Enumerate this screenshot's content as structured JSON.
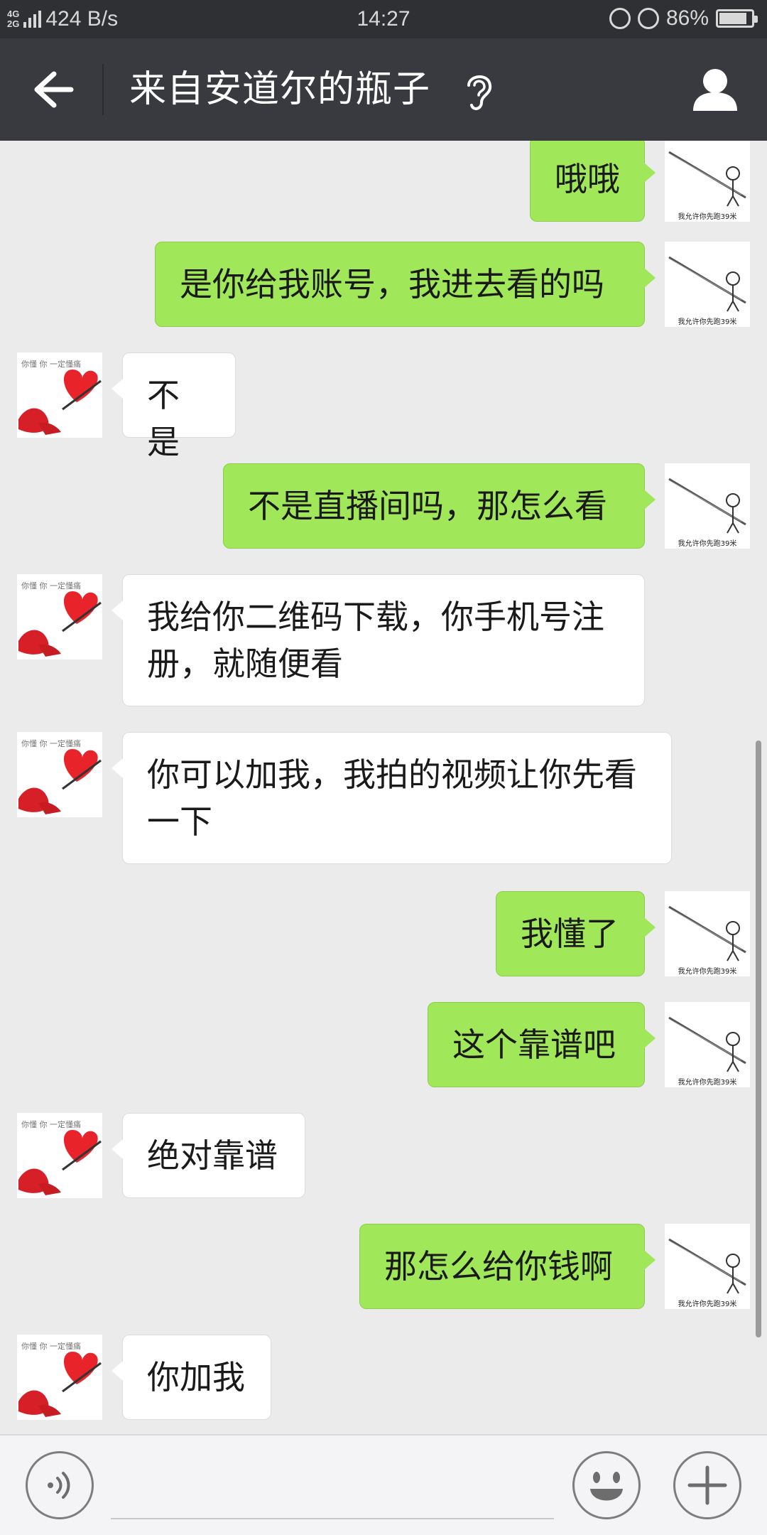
{
  "status_bar": {
    "network_top": "4G",
    "network_bottom": "2G",
    "speed": "424 B/s",
    "time": "14:27",
    "battery": "86%",
    "battery_level": 0.86
  },
  "header": {
    "title": "来自安道尔的瓶子",
    "back_icon": "arrow-left-icon",
    "ear_icon": "ear-icon",
    "profile_icon": "person-icon"
  },
  "messages": [
    {
      "sender": "me",
      "text": "哦哦"
    },
    {
      "sender": "me",
      "text": "是你给我账号，我进去看的吗"
    },
    {
      "sender": "other",
      "text": "不是"
    },
    {
      "sender": "me",
      "text": "不是直播间吗，那怎么看"
    },
    {
      "sender": "other",
      "text": "我给你二维码下载，你手机号注\n册，就随便看"
    },
    {
      "sender": "other",
      "text": "你可以加我，我拍的视频让你先看\n一下"
    },
    {
      "sender": "me",
      "text": "我懂了"
    },
    {
      "sender": "me",
      "text": "这个靠谱吧"
    },
    {
      "sender": "other",
      "text": "绝对靠谱"
    },
    {
      "sender": "me",
      "text": "那怎么给你钱啊"
    },
    {
      "sender": "other",
      "text": "你加我"
    }
  ],
  "avatars": {
    "me_caption": "我允许你先跑39米",
    "other_caption": "你懂 你 一定懂痛"
  },
  "input_bar": {
    "voice_icon": "voice-icon",
    "emoji_icon": "emoji-icon",
    "plus_icon": "plus-icon"
  },
  "colors": {
    "header_bg": "#393a3f",
    "my_bubble": "#a0e75a",
    "their_bubble": "#ffffff",
    "chat_bg": "#ebebeb"
  }
}
